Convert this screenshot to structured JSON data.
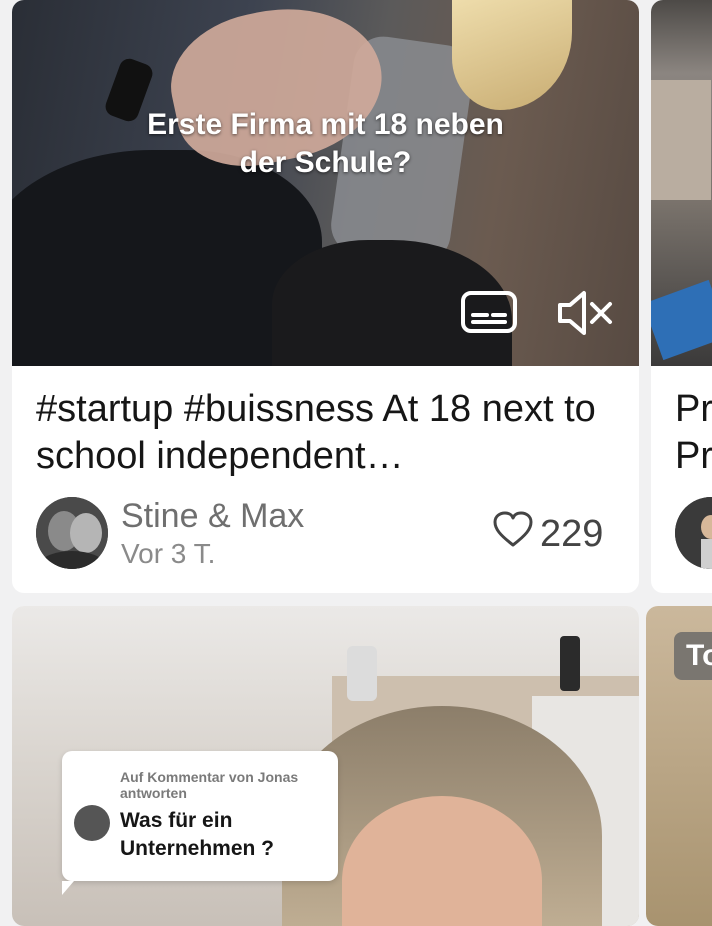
{
  "cards": [
    {
      "overlay_caption_line1": "Erste Firma mit 18 neben",
      "overlay_caption_line2": "der Schule?",
      "title": "#startup #buissness At 18 next to school independent…",
      "author": "Stine & Max",
      "time": "Vor 3 T.",
      "likes": "229",
      "icons": [
        "subtitles-icon",
        "muted-speaker-icon",
        "heart-icon"
      ]
    },
    {
      "reply_label": "Auf Kommentar von Jonas antworten",
      "reply_question": "Was für ein Unternehmen ?"
    }
  ],
  "right_column": {
    "title_line1": "Pr",
    "title_line2": "Pr",
    "badge": "To"
  },
  "colors": {
    "background": "#f1f1f2",
    "card": "#ffffff",
    "title_text": "#161616",
    "meta_text": "#6f6f6f"
  }
}
